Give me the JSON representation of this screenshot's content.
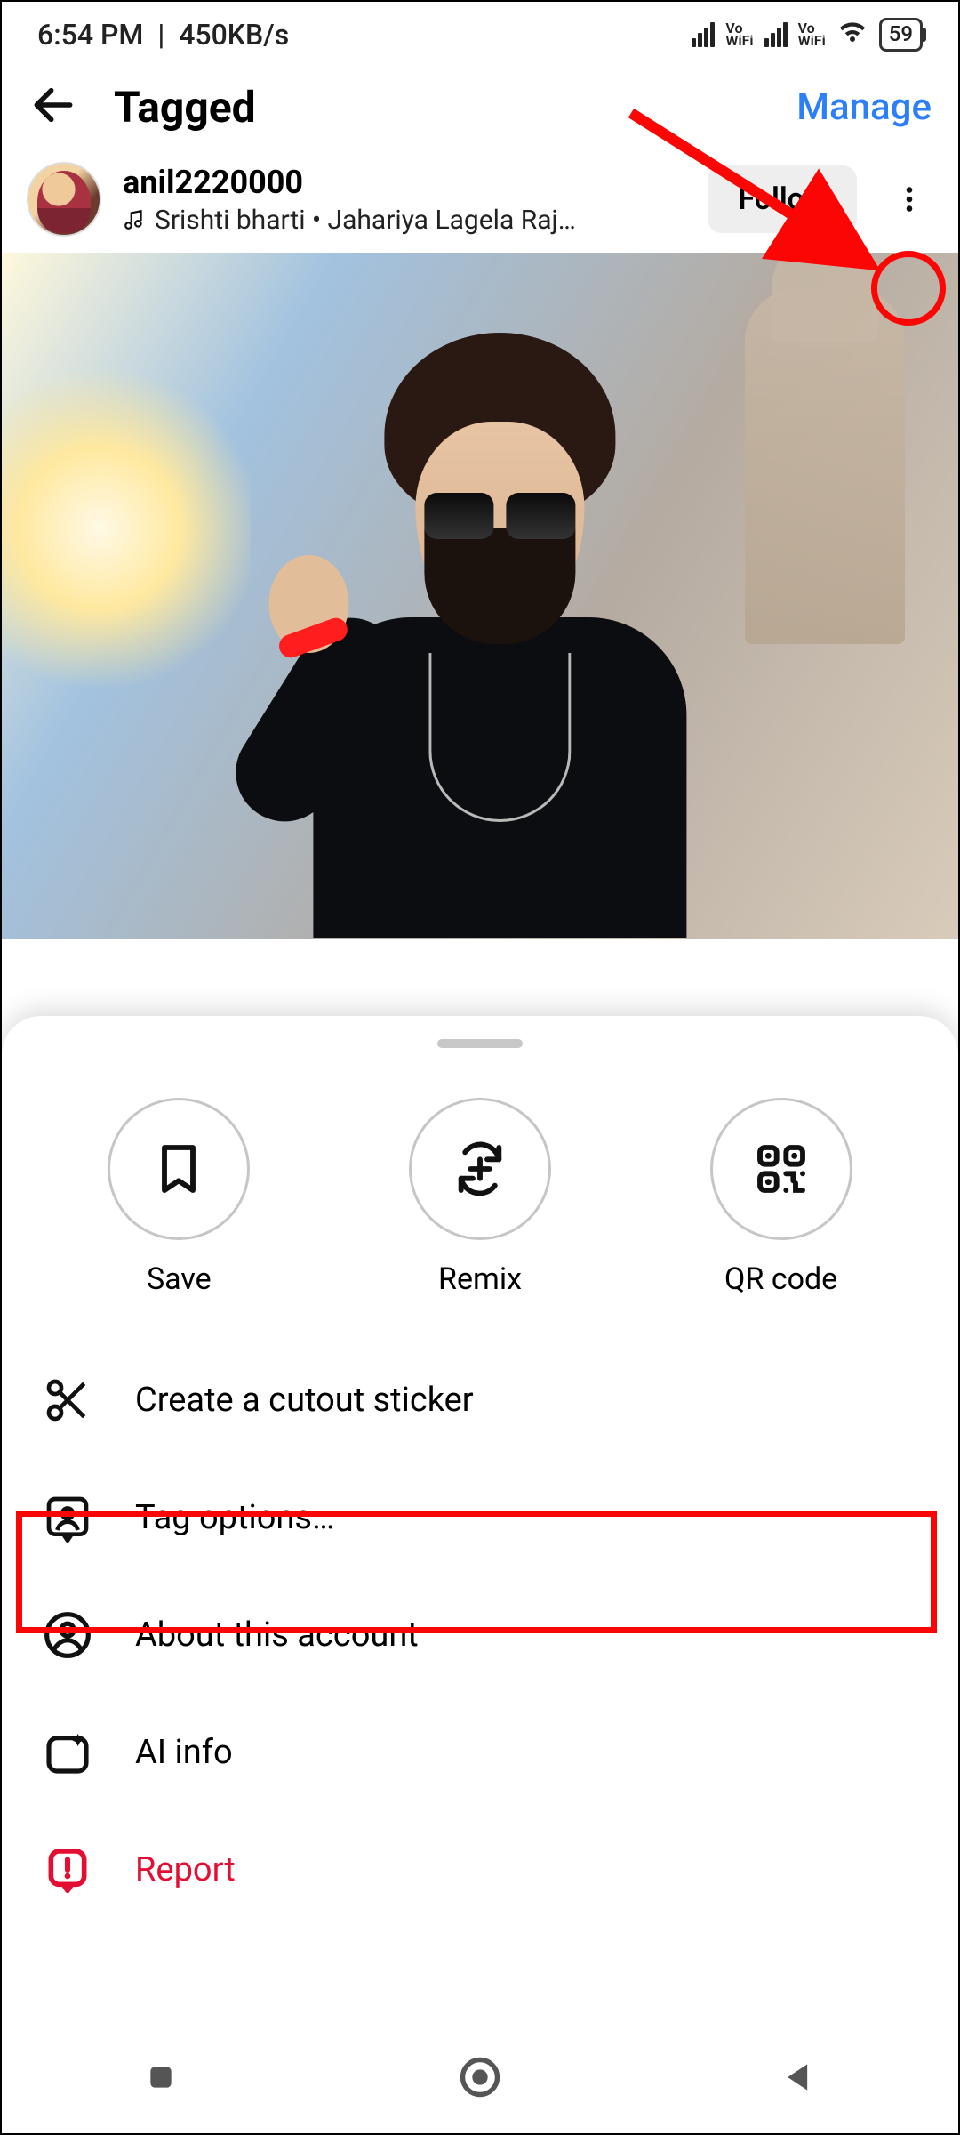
{
  "status": {
    "time": "6:54 PM",
    "net_speed": "450KB/s",
    "battery": "59",
    "vowifi_label": "Vo\nWiFi"
  },
  "appbar": {
    "title": "Tagged",
    "manage": "Manage"
  },
  "post": {
    "username": "anil2220000",
    "audio": "Srishti bharti • Jahariya Lagela Raj…",
    "follow": "Follow"
  },
  "sheet": {
    "actions": {
      "save": "Save",
      "remix": "Remix",
      "qr": "QR code"
    },
    "menu": {
      "cutout": "Create a cutout sticker",
      "tag": "Tag options…",
      "about": "About this account",
      "ai": "AI info",
      "report": "Report"
    }
  }
}
